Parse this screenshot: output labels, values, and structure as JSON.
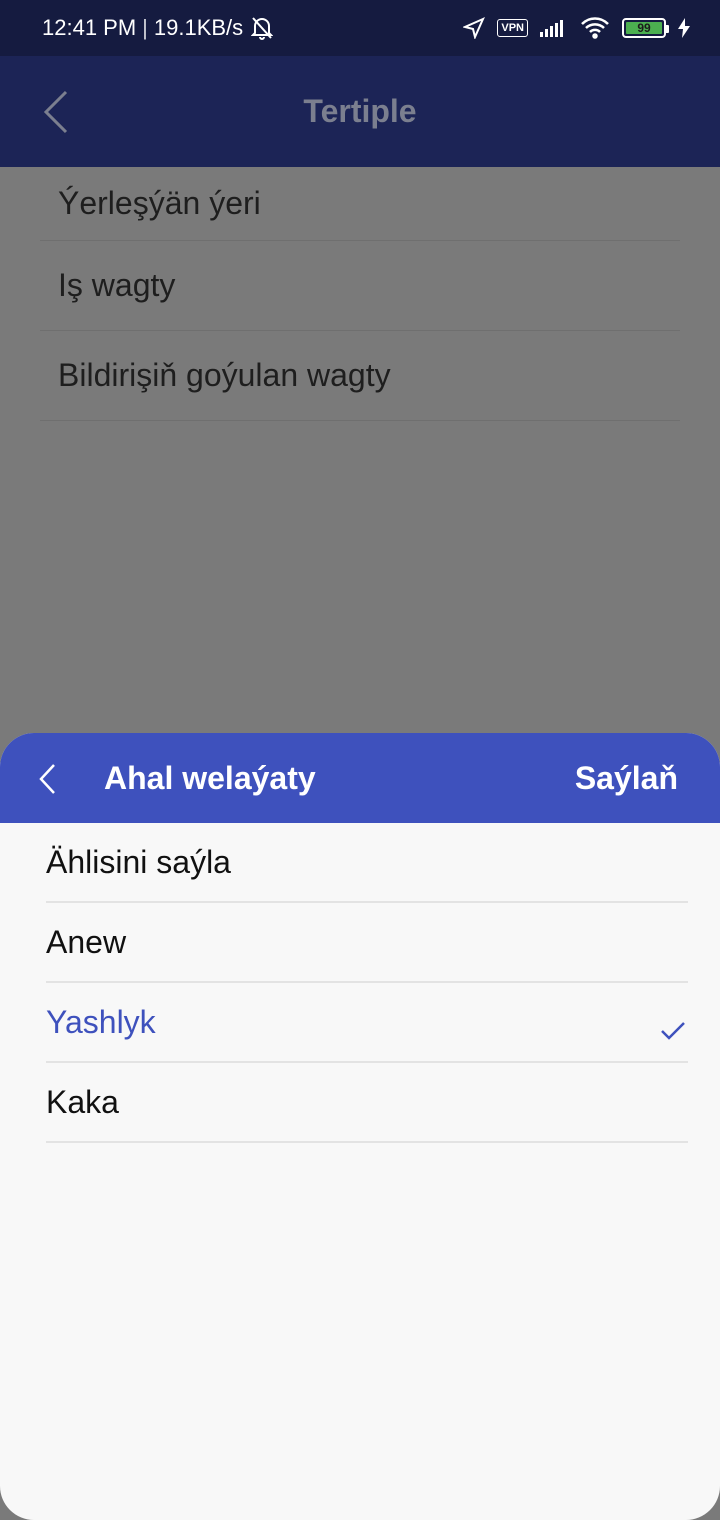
{
  "status_bar": {
    "time": "12:41 PM",
    "separator": "|",
    "speed": "19.1KB/s",
    "vpn_label": "VPN",
    "battery_level": "99"
  },
  "app_bar": {
    "title": "Tertiple"
  },
  "sort_list": {
    "items": [
      {
        "label": "Ýerleşýän ýeri"
      },
      {
        "label": "Iş wagty"
      },
      {
        "label": "Bildirişiň goýulan wagty"
      }
    ]
  },
  "sheet": {
    "title": "Ahal welaýaty",
    "confirm_label": "Saýlaň",
    "accent_color": "#3e51bd",
    "options": [
      {
        "label": "Ählisini saýla",
        "selected": false
      },
      {
        "label": "Anew",
        "selected": false
      },
      {
        "label": "Yashlyk",
        "selected": true
      },
      {
        "label": "Kaka",
        "selected": false
      }
    ]
  }
}
